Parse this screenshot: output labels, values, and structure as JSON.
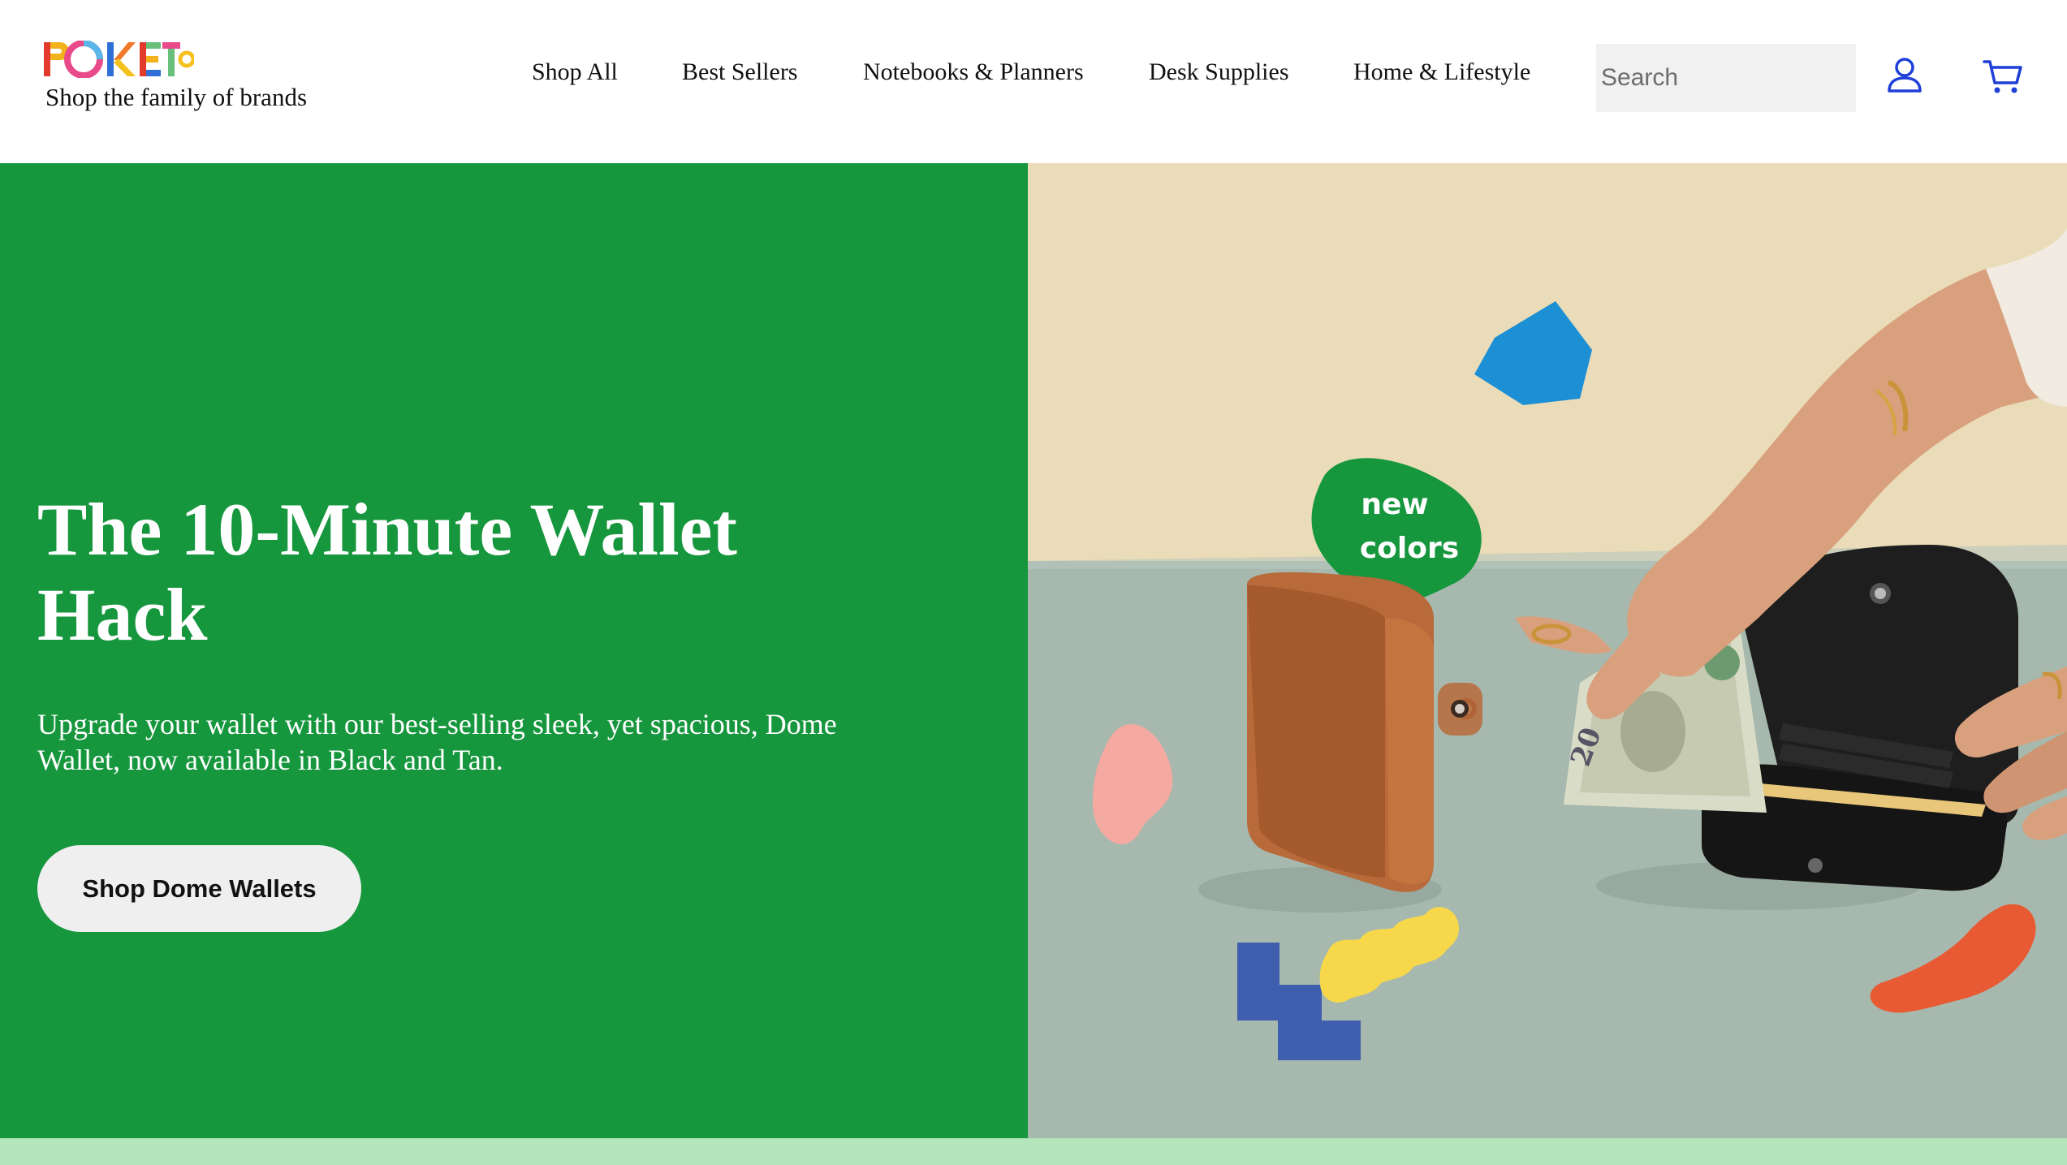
{
  "brand": {
    "logo_text": "POKETO",
    "tagline": "Shop the family of brands"
  },
  "nav": {
    "items": [
      {
        "label": "Shop All"
      },
      {
        "label": "Best Sellers"
      },
      {
        "label": "Notebooks & Planners"
      },
      {
        "label": "Desk Supplies"
      },
      {
        "label": "Home & Lifestyle"
      }
    ]
  },
  "search": {
    "placeholder": "Search",
    "value": ""
  },
  "header_icons": {
    "account": "user-icon",
    "cart": "cart-icon",
    "icon_color": "#1f3fd9"
  },
  "hero": {
    "title": "The 10-Minute Wallet Hack",
    "subtitle": "Upgrade your wallet with our best-selling sleek, yet spacious, Dome Wallet, now available in Black and Tan.",
    "cta_label": "Shop Dome Wallets",
    "background_color": "#16963d",
    "image": {
      "badge_text_line1": "new",
      "badge_text_line2": "colors",
      "bill_label": "20"
    }
  },
  "footer_band": {
    "color": "#b5e6bb"
  }
}
